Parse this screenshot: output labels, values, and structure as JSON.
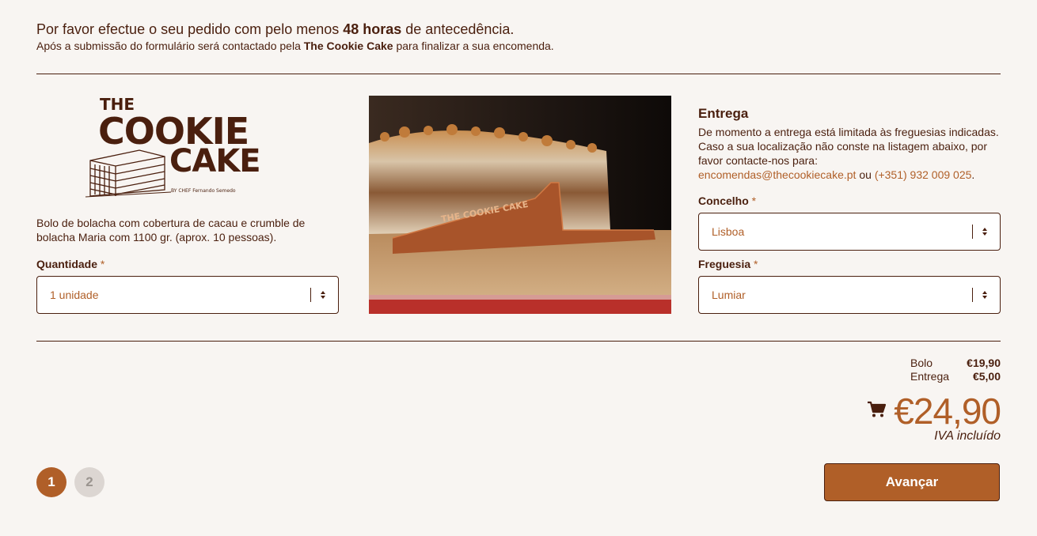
{
  "intro": {
    "line1_pre": "Por favor efectue o seu pedido com pelo menos ",
    "line1_bold": "48 horas",
    "line1_post": " de antecedência.",
    "line2_pre": "Após a submissão do formulário será contactado pela ",
    "line2_bold": "The Cookie Cake",
    "line2_post": " para finalizar a sua encomenda."
  },
  "logo": {
    "line1": "THE",
    "line2": "COOKIE",
    "line3": "CAKE",
    "signature": "BY CHEF Fernando Semedo"
  },
  "product": {
    "description": "Bolo de bolacha com cobertura de cacau e crumble de bolacha Maria com 1100 gr. (aprox. 10 pessoas).",
    "quantity_label": "Quantidade",
    "required_mark": "*",
    "quantity_value": "1 unidade",
    "photo_brand": "THE COOKIE CAKE"
  },
  "delivery": {
    "title": "Entrega",
    "text": "De momento a entrega está limitada às freguesias indicadas. Caso a sua localização não conste na listagem abaixo, por favor contacte-nos para:",
    "email": "encomendas@thecookiecake.pt",
    "or": " ou ",
    "phone": "(+351) 932 009 025",
    "period": ".",
    "concelho_label": "Concelho",
    "concelho_value": "Lisboa",
    "freguesia_label": "Freguesia",
    "freguesia_value": "Lumiar"
  },
  "summary": {
    "cake_label": "Bolo",
    "cake_price": "€19,90",
    "delivery_label": "Entrega",
    "delivery_price": "€5,00",
    "total": "€24,90",
    "tax_note": "IVA incluído"
  },
  "steps": [
    "1",
    "2"
  ],
  "next_button": "Avançar",
  "colors": {
    "brand": "#b05f28",
    "text": "#4a1f0e",
    "background": "#f8f5f2"
  }
}
